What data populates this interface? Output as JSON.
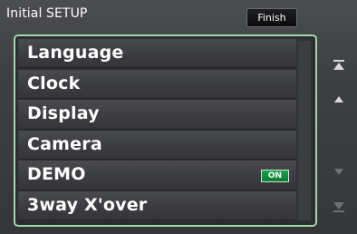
{
  "header": {
    "title": "Initial SETUP",
    "finish_label": "Finish"
  },
  "menu": {
    "items": [
      {
        "label": "Language"
      },
      {
        "label": "Clock"
      },
      {
        "label": "Display"
      },
      {
        "label": "Camera"
      },
      {
        "label": "DEMO",
        "toggle": "ON"
      },
      {
        "label": "3way X'over"
      }
    ]
  },
  "side_controls": [
    {
      "icon": "scroll-top-icon"
    },
    {
      "icon": "scroll-up-icon"
    },
    {
      "icon": "scroll-down-icon"
    },
    {
      "icon": "scroll-bottom-icon"
    }
  ],
  "colors": {
    "accent_frame": "#9fd7aa",
    "toggle_on": "#16a24a",
    "background": "#3e4044"
  }
}
